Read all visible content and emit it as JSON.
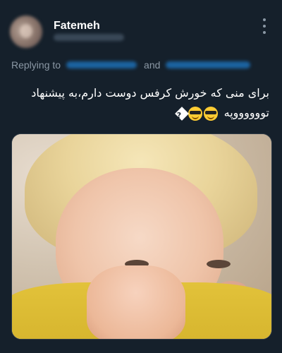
{
  "tweet": {
    "display_name": "Fatemeh",
    "reply_prefix": "Replying to",
    "reply_joiner": "and",
    "text_line_1": "برای منی که خورش کرفس دوست دارم،به پیشنهاد",
    "text_line_2": "تووووووپه",
    "icons": {
      "more": "more-vertical-icon",
      "emoji": "sunglasses-emoji-icon",
      "missing_glyph": "replacement-character-icon"
    },
    "colors": {
      "background": "#15202b",
      "secondary_text": "#8b98a5",
      "accent": "#1d9bf0"
    }
  }
}
